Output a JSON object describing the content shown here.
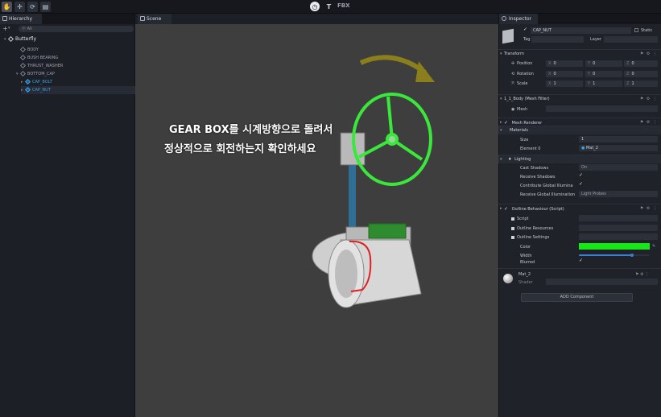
{
  "toolbar": {
    "fbx_label": "FBX",
    "text_tool_label": "T"
  },
  "hierarchy": {
    "tab_label": "Hierarchy",
    "add_label": "+",
    "search_placeholder": "ⓟ All",
    "root": "Butterfly",
    "items": [
      {
        "label": "BODY"
      },
      {
        "label": "BUSH BEARING"
      },
      {
        "label": "THRUST_WASHER"
      },
      {
        "label": "BOTTOM_CAP"
      },
      {
        "label": "CAP_BOLT"
      },
      {
        "label": "CAP_NUT"
      }
    ]
  },
  "scene": {
    "tab_label": "Scene",
    "instruction_line1": "GEAR BOX를 시계방향으로 돌려서",
    "instruction_line2": "정상적으로 회전하는지 확인하세요"
  },
  "inspector": {
    "tab_label": "Inspector",
    "object_name": "CAP_NUT",
    "static_label": "Static",
    "tag_label": "Tag",
    "layer_label": "Layer",
    "transform": {
      "title": "Transform",
      "position_label": "Position",
      "rotation_label": "Rotation",
      "scale_label": "Scale",
      "position": {
        "x": "0",
        "y": "0",
        "z": "0"
      },
      "rotation": {
        "x": "0",
        "y": "0",
        "z": "0"
      },
      "scale": {
        "x": "1",
        "y": "1",
        "z": "1"
      }
    },
    "mesh_filter": {
      "title": "1_1_Body (Mesh Filter)",
      "mesh_label": "Mesh"
    },
    "mesh_renderer": {
      "title": "Mesh Renderer",
      "materials_label": "Materials",
      "size_label": "Size",
      "size_value": "1",
      "element0_label": "Element 0",
      "element0_value": "Mat_2",
      "lighting_label": "Lighting",
      "cast_shadows_label": "Cast Shadows",
      "cast_shadows_value": "On",
      "receive_shadows_label": "Receive Shadows",
      "contribute_gi_label": "Contribute Global Illumina",
      "receive_gi_label": "Receive Global Illumination",
      "receive_gi_value": "Light Probes"
    },
    "outline": {
      "title": "Outline Behaviour (Script)",
      "script_label": "Script",
      "resources_label": "Outline Resources",
      "settings_label": "Outline Settings",
      "color_label": "Color",
      "width_label": "Width",
      "blurred_label": "Blurred",
      "color_value": "#19e619",
      "width_value_fraction": 0.75
    },
    "material": {
      "name": "Mat_2",
      "shader_label": "Shader"
    },
    "add_component_label": "ADD Component"
  }
}
